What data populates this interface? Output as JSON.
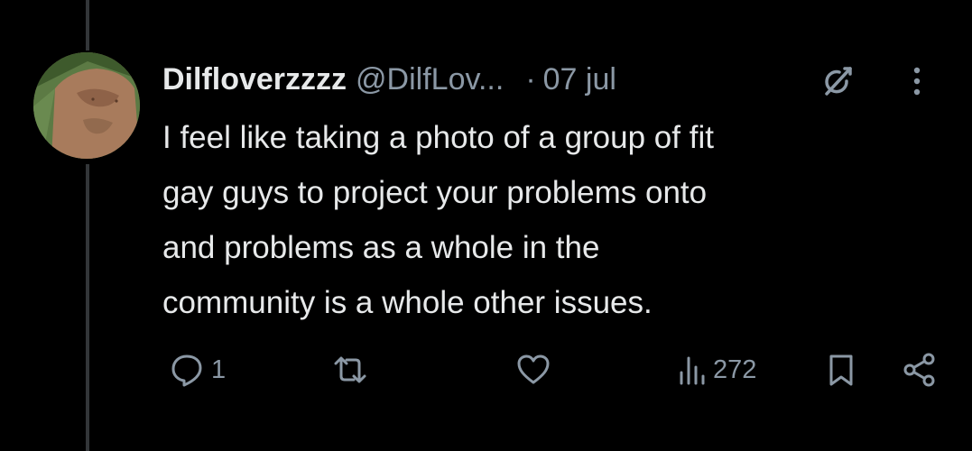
{
  "tweet": {
    "display_name": "Dilfloverzzzz",
    "handle": "@DilfLov...",
    "separator": "·",
    "date": "07 jul",
    "text": "I feel like taking a photo of a group of fit\ngay guys to project your problems onto\nand problems as a whole in the\ncommunity is a whole other issues."
  },
  "actions": {
    "reply_count": "1",
    "retweet_count": "",
    "like_count": "",
    "views_count": "272"
  },
  "colors": {
    "background": "#000000",
    "primary_text": "#e7e9ea",
    "secondary_text": "#8b98a5",
    "thread_line": "#333639"
  },
  "icons": {
    "avatar": "profile-photo",
    "header_right": [
      "grok-icon",
      "more-icon"
    ],
    "action_bar": [
      "reply-icon",
      "retweet-icon",
      "like-icon",
      "views-icon",
      "bookmark-icon",
      "share-icon"
    ]
  }
}
